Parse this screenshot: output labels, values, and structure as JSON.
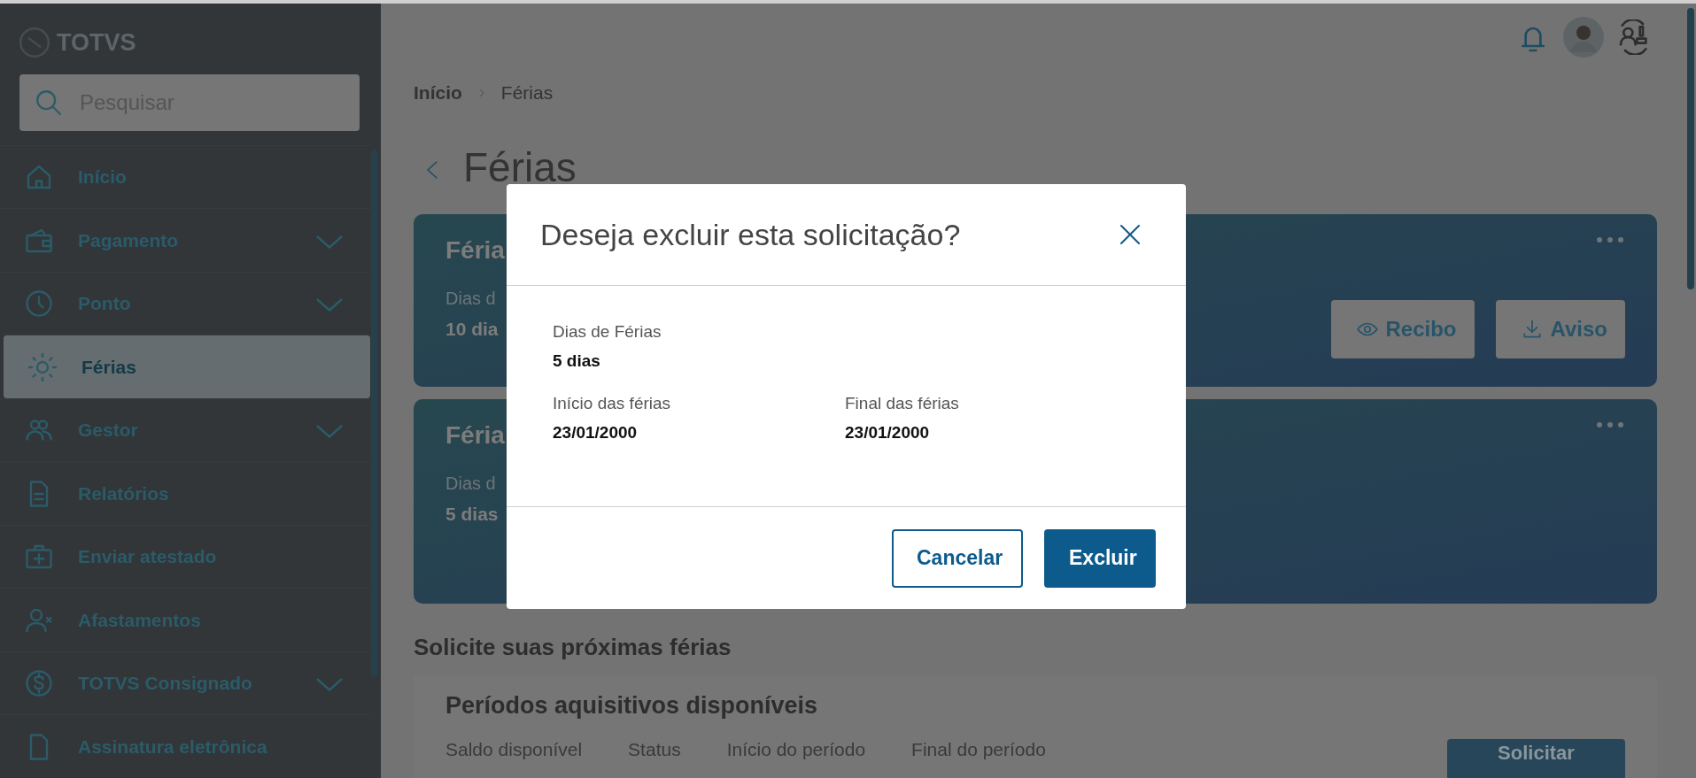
{
  "sidebar": {
    "logo": "TOTVS",
    "search": {
      "placeholder": "Pesquisar"
    },
    "items": [
      {
        "label": "Início",
        "expandable": false,
        "selected": false
      },
      {
        "label": "Pagamento",
        "expandable": true,
        "selected": false
      },
      {
        "label": "Ponto",
        "expandable": true,
        "selected": false
      },
      {
        "label": "Férias",
        "expandable": false,
        "selected": true
      },
      {
        "label": "Gestor",
        "expandable": true,
        "selected": false
      },
      {
        "label": "Relatórios",
        "expandable": false,
        "selected": false
      },
      {
        "label": "Enviar atestado",
        "expandable": false,
        "selected": false
      },
      {
        "label": "Afastamentos",
        "expandable": false,
        "selected": false
      },
      {
        "label": "TOTVS Consignado",
        "expandable": true,
        "selected": false
      },
      {
        "label": "Assinatura eletrônica",
        "expandable": false,
        "selected": false
      }
    ]
  },
  "breadcrumb": [
    {
      "label": "Início",
      "link": true
    },
    {
      "label": "Férias",
      "link": false
    }
  ],
  "page_title": "Férias",
  "cards": [
    {
      "title": "Féria",
      "label": "Dias d",
      "value": "10 dia",
      "buttons": [
        "Recibo",
        "Aviso"
      ]
    },
    {
      "title": "Féria",
      "label": "Dias d",
      "value": "5 dias"
    }
  ],
  "section_title": "Solicite suas próximas férias",
  "periods": {
    "title": "Períodos aquisitivos disponíveis",
    "columns": [
      "Saldo disponível",
      "Status",
      "Início do período",
      "Final do período"
    ],
    "button": "Solicitar"
  },
  "modal": {
    "title": "Deseja excluir esta solicitação?",
    "rows": [
      [
        {
          "label": "Dias de Férias",
          "value": "5 dias"
        }
      ],
      [
        {
          "label": "Início das férias",
          "value": "23/01/2000"
        },
        {
          "label": "Final das férias",
          "value": "23/01/2000"
        }
      ]
    ],
    "buttons": [
      {
        "label": "Cancelar",
        "kind": "secondary"
      },
      {
        "label": "Excluir",
        "kind": "primary"
      }
    ]
  }
}
